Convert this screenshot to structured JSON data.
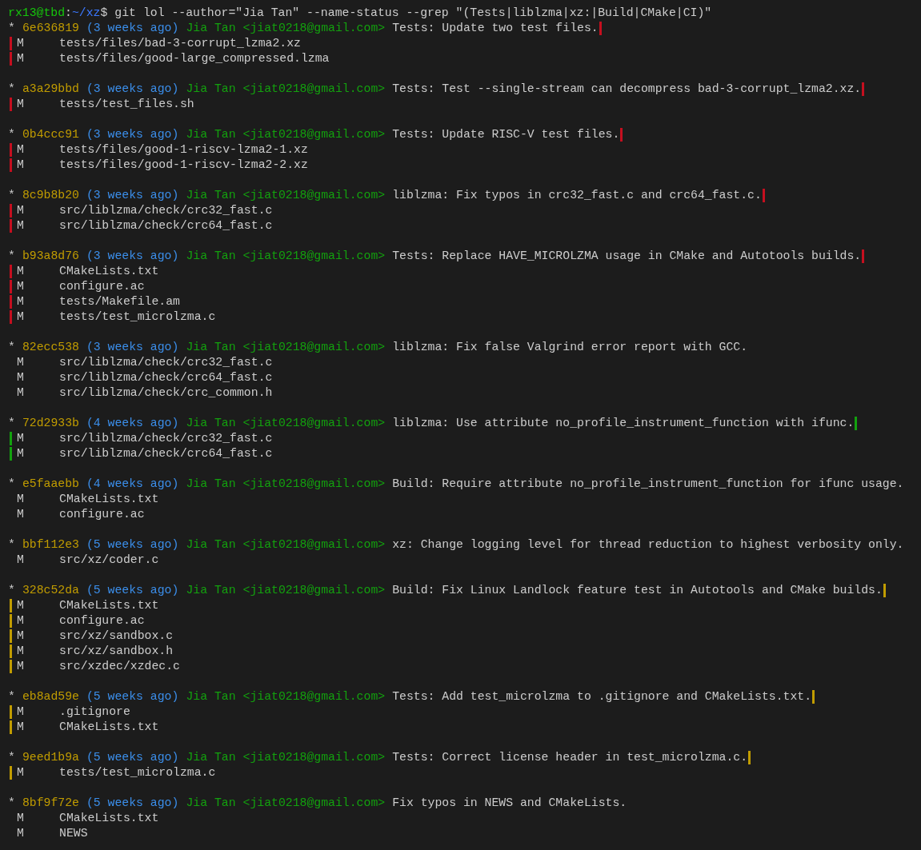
{
  "prompt": {
    "user_host": "rx13@tbd",
    "separator": ":",
    "path": "~/xz",
    "symbol": "$",
    "command": "git lol --author=\"Jia Tan\" --name-status --grep \"(Tests|liblzma|xz:|Build|CMake|CI)\""
  },
  "commits": [
    {
      "graph": "*",
      "hash": "6e636819",
      "age": "(3 weeks ago)",
      "author": "Jia Tan",
      "email": "<jiat0218@gmail.com>",
      "subject": "Tests: Update two test files.",
      "color": "#c50f1f",
      "files": [
        {
          "status": "M",
          "path": "tests/files/bad-3-corrupt_lzma2.xz"
        },
        {
          "status": "M",
          "path": "tests/files/good-large_compressed.lzma"
        }
      ]
    },
    {
      "graph": "*",
      "hash": "a3a29bbd",
      "age": "(3 weeks ago)",
      "author": "Jia Tan",
      "email": "<jiat0218@gmail.com>",
      "subject": "Tests: Test --single-stream can decompress bad-3-corrupt_lzma2.xz.",
      "color": "#c50f1f",
      "files": [
        {
          "status": "M",
          "path": "tests/test_files.sh"
        }
      ]
    },
    {
      "graph": "*",
      "hash": "0b4ccc91",
      "age": "(3 weeks ago)",
      "author": "Jia Tan",
      "email": "<jiat0218@gmail.com>",
      "subject": "Tests: Update RISC-V test files.",
      "color": "#c50f1f",
      "files": [
        {
          "status": "M",
          "path": "tests/files/good-1-riscv-lzma2-1.xz"
        },
        {
          "status": "M",
          "path": "tests/files/good-1-riscv-lzma2-2.xz"
        }
      ]
    },
    {
      "graph": "*",
      "hash": "8c9b8b20",
      "age": "(3 weeks ago)",
      "author": "Jia Tan",
      "email": "<jiat0218@gmail.com>",
      "subject": "liblzma: Fix typos in crc32_fast.c and crc64_fast.c.",
      "color": "#c50f1f",
      "files": [
        {
          "status": "M",
          "path": "src/liblzma/check/crc32_fast.c"
        },
        {
          "status": "M",
          "path": "src/liblzma/check/crc64_fast.c"
        }
      ]
    },
    {
      "graph": "*",
      "hash": "b93a8d76",
      "age": "(3 weeks ago)",
      "author": "Jia Tan",
      "email": "<jiat0218@gmail.com>",
      "subject": "Tests: Replace HAVE_MICROLZMA usage in CMake and Autotools builds.",
      "color": "#c50f1f",
      "files": [
        {
          "status": "M",
          "path": "CMakeLists.txt"
        },
        {
          "status": "M",
          "path": "configure.ac"
        },
        {
          "status": "M",
          "path": "tests/Makefile.am"
        },
        {
          "status": "M",
          "path": "tests/test_microlzma.c"
        }
      ]
    },
    {
      "graph": "*",
      "hash": "82ecc538",
      "age": "(3 weeks ago)",
      "author": "Jia Tan",
      "email": "<jiat0218@gmail.com>",
      "subject": "liblzma: Fix false Valgrind error report with GCC.",
      "files": [
        {
          "status": "M",
          "path": "src/liblzma/check/crc32_fast.c"
        },
        {
          "status": "M",
          "path": "src/liblzma/check/crc64_fast.c"
        },
        {
          "status": "M",
          "path": "src/liblzma/check/crc_common.h"
        }
      ]
    },
    {
      "graph": "*",
      "hash": "72d2933b",
      "age": "(4 weeks ago)",
      "author": "Jia Tan",
      "email": "<jiat0218@gmail.com>",
      "subject": "liblzma: Use attribute no_profile_instrument_function with ifunc.",
      "color": "#13a10e",
      "files": [
        {
          "status": "M",
          "path": "src/liblzma/check/crc32_fast.c"
        },
        {
          "status": "M",
          "path": "src/liblzma/check/crc64_fast.c"
        }
      ]
    },
    {
      "graph": "*",
      "hash": "e5faaebb",
      "age": "(4 weeks ago)",
      "author": "Jia Tan",
      "email": "<jiat0218@gmail.com>",
      "subject": "Build: Require attribute no_profile_instrument_function for ifunc usage.",
      "files": [
        {
          "status": "M",
          "path": "CMakeLists.txt"
        },
        {
          "status": "M",
          "path": "configure.ac"
        }
      ]
    },
    {
      "graph": "*",
      "hash": "bbf112e3",
      "age": "(5 weeks ago)",
      "author": "Jia Tan",
      "email": "<jiat0218@gmail.com>",
      "subject": "xz: Change logging level for thread reduction to highest verbosity only.",
      "files": [
        {
          "status": "M",
          "path": "src/xz/coder.c"
        }
      ]
    },
    {
      "graph": "*",
      "hash": "328c52da",
      "age": "(5 weeks ago)",
      "author": "Jia Tan",
      "email": "<jiat0218@gmail.com>",
      "subject": "Build: Fix Linux Landlock feature test in Autotools and CMake builds.",
      "color": "#c19c00",
      "files": [
        {
          "status": "M",
          "path": "CMakeLists.txt"
        },
        {
          "status": "M",
          "path": "configure.ac"
        },
        {
          "status": "M",
          "path": "src/xz/sandbox.c"
        },
        {
          "status": "M",
          "path": "src/xz/sandbox.h"
        },
        {
          "status": "M",
          "path": "src/xzdec/xzdec.c"
        }
      ]
    },
    {
      "graph": "*",
      "hash": "eb8ad59e",
      "age": "(5 weeks ago)",
      "author": "Jia Tan",
      "email": "<jiat0218@gmail.com>",
      "subject": "Tests: Add test_microlzma to .gitignore and CMakeLists.txt.",
      "color": "#c19c00",
      "files": [
        {
          "status": "M",
          "path": ".gitignore"
        },
        {
          "status": "M",
          "path": "CMakeLists.txt"
        }
      ]
    },
    {
      "graph": "*",
      "hash": "9eed1b9a",
      "age": "(5 weeks ago)",
      "author": "Jia Tan",
      "email": "<jiat0218@gmail.com>",
      "subject": "Tests: Correct license header in test_microlzma.c.",
      "color": "#c19c00",
      "files": [
        {
          "status": "M",
          "path": "tests/test_microlzma.c"
        }
      ]
    },
    {
      "graph": "*",
      "hash": "8bf9f72e",
      "age": "(5 weeks ago)",
      "author": "Jia Tan",
      "email": "<jiat0218@gmail.com>",
      "subject": "Fix typos in NEWS and CMakeLists.",
      "files": [
        {
          "status": "M",
          "path": "CMakeLists.txt"
        },
        {
          "status": "M",
          "path": "NEWS"
        }
      ]
    }
  ]
}
